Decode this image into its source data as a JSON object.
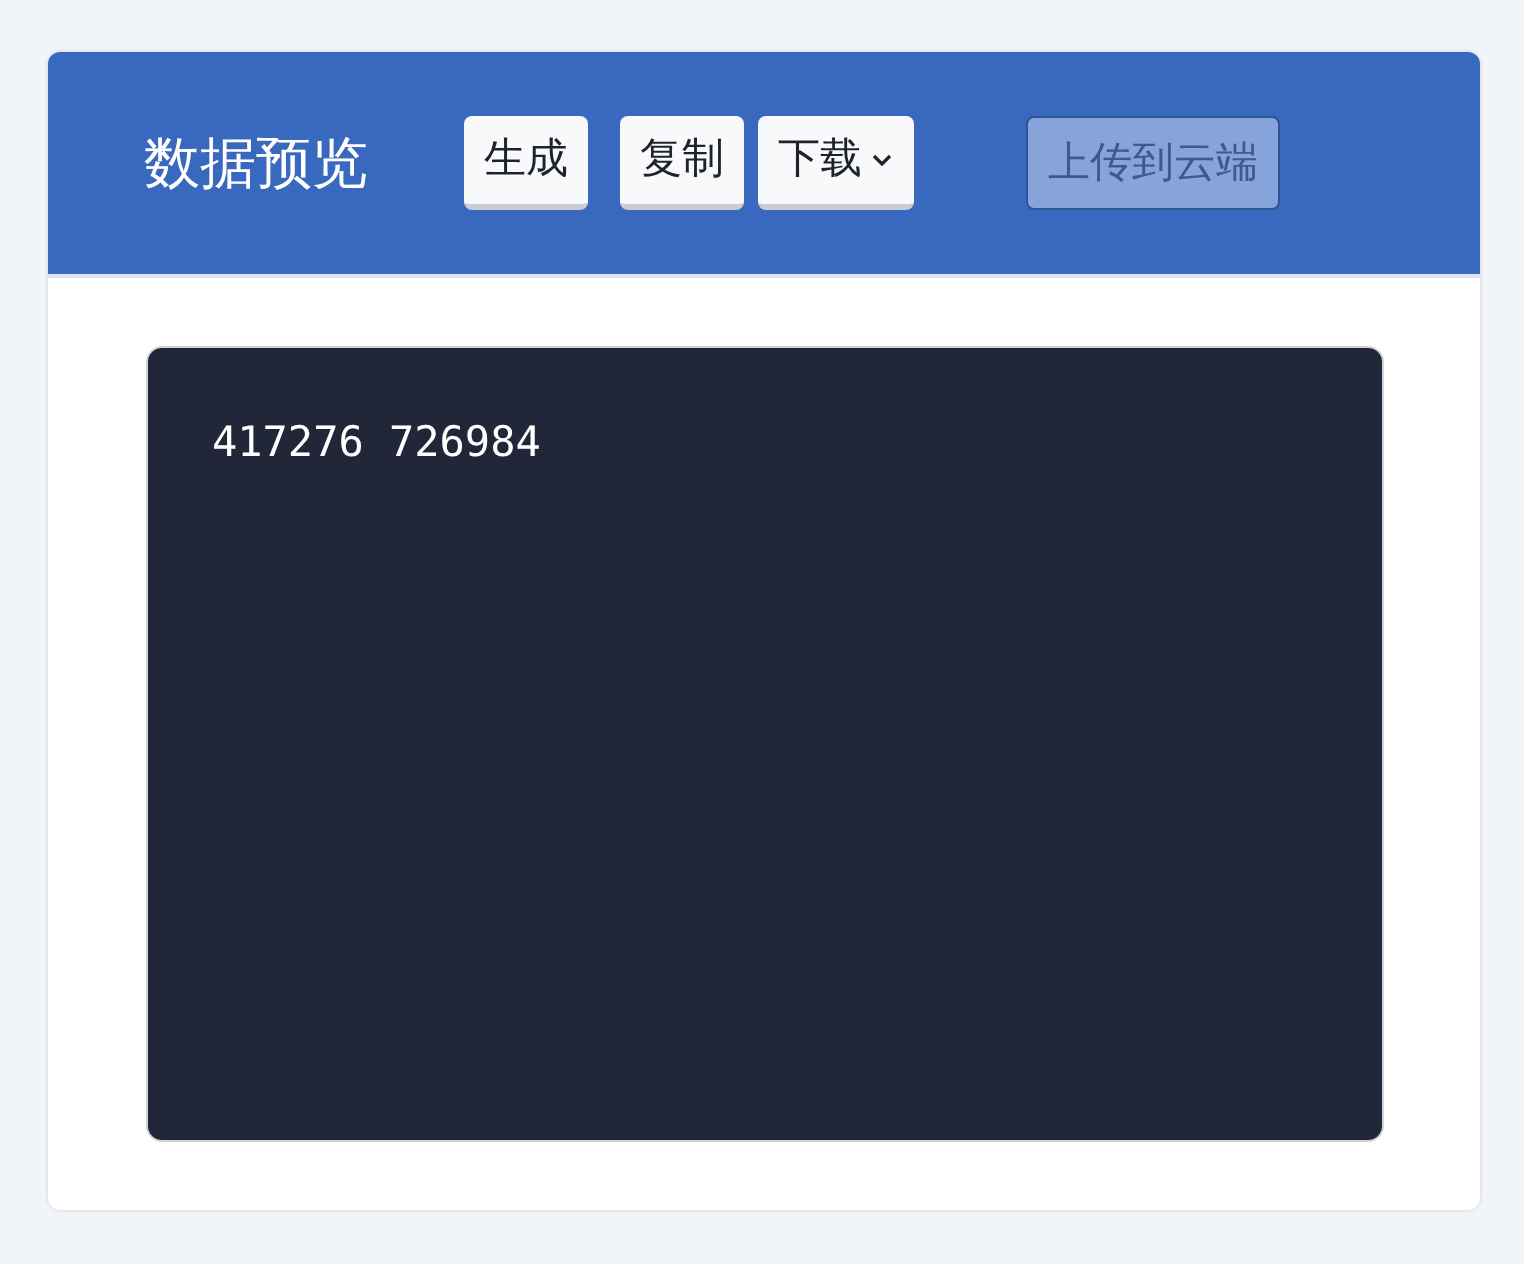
{
  "header": {
    "title": "数据预览"
  },
  "buttons": [
    {
      "label": "生成",
      "kind": "plain",
      "disabled": false
    },
    {
      "label": "复制",
      "kind": "plain",
      "disabled": false
    },
    {
      "label": "下载",
      "kind": "dropdown",
      "disabled": false
    },
    {
      "label": "上传到云端",
      "kind": "plain",
      "disabled": true
    }
  ],
  "output": {
    "text": "417276 726984"
  }
}
